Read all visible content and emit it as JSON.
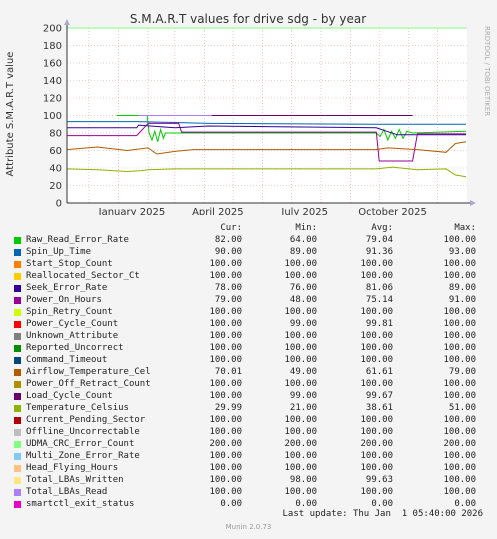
{
  "chart_data": {
    "type": "line",
    "title": "S.M.A.R.T values for drive sdg - by year",
    "ylabel": "Attribute S.M.A.R.T value",
    "ylim": [
      0,
      200
    ],
    "y_ticks": [
      "0",
      "20",
      "40",
      "60",
      "80",
      "100",
      "120",
      "140",
      "160",
      "180",
      "200"
    ],
    "x_ticks": [
      "January 2025",
      "April 2025",
      "July 2025",
      "October 2025"
    ],
    "grid": true,
    "series": [
      {
        "name": "Raw_Read_Error_Rate",
        "color": "#00cc00",
        "cur": "82.00",
        "min": "64.00",
        "avg": "79.04",
        "max": "100.00",
        "x": [
          "2024-12-30",
          "2025-01-31",
          "2025-02-02",
          "2025-02-05",
          "2025-02-08",
          "2025-02-11",
          "2025-02-14",
          "2025-02-17",
          "2025-02-19",
          "2025-03-07",
          "2025-04-01",
          "2025-09-28",
          "2025-10-02",
          "2025-10-06",
          "2025-10-10",
          "2025-10-14",
          "2025-10-18",
          "2025-10-22",
          "2025-10-26",
          "2025-10-30",
          "2025-11-05",
          "2025-12-31"
        ],
        "y": [
          100,
          100,
          80,
          72,
          82,
          70,
          84,
          74,
          80,
          80,
          80,
          80,
          76,
          84,
          72,
          82,
          74,
          84,
          74,
          82,
          80,
          82
        ]
      },
      {
        "name": "Spin_Up_Time",
        "color": "#0066b3",
        "cur": "90.00",
        "min": "89.00",
        "avg": "91.36",
        "max": "93.00",
        "x": [
          "2024-11-08",
          "2025-01-20",
          "2025-03-01",
          "2025-04-05",
          "2025-09-28",
          "2025-12-31"
        ],
        "y": [
          93,
          93,
          92,
          91,
          90,
          90
        ]
      },
      {
        "name": "Start_Stop_Count",
        "color": "#ff8000",
        "cur": "100.00",
        "min": "100.00",
        "avg": "100.00",
        "max": "100.00",
        "x": [
          "2025-01-22",
          "2025-04-08"
        ],
        "y": [
          100,
          100
        ]
      },
      {
        "name": "Reallocated_Sector_Ct",
        "color": "#ffcc00",
        "cur": "100.00",
        "min": "100.00",
        "avg": "100.00",
        "max": "100.00",
        "x": [
          "2025-01-22",
          "2025-04-08"
        ],
        "y": [
          100,
          100
        ]
      },
      {
        "name": "Seek_Error_Rate",
        "color": "#330099",
        "cur": "78.00",
        "min": "76.00",
        "avg": "81.06",
        "max": "89.00",
        "x": [
          "2024-11-08",
          "2025-01-20",
          "2025-01-22",
          "2025-03-01",
          "2025-04-05",
          "2025-09-28",
          "2025-10-20",
          "2025-12-31"
        ],
        "y": [
          86,
          86,
          89,
          86,
          88,
          86,
          78,
          78
        ]
      },
      {
        "name": "Power_On_Hours",
        "color": "#990099",
        "cur": "79.00",
        "min": "48.00",
        "avg": "75.14",
        "max": "91.00",
        "x": [
          "2024-11-08",
          "2025-01-20",
          "2025-02-01",
          "2025-03-05",
          "2025-03-08",
          "2025-04-05",
          "2025-09-28",
          "2025-10-01",
          "2025-11-05",
          "2025-11-10",
          "2025-12-31"
        ],
        "y": [
          77,
          77,
          91,
          91,
          81,
          81,
          81,
          48,
          48,
          79,
          79
        ]
      },
      {
        "name": "Spin_Retry_Count",
        "color": "#ccff00",
        "cur": "100.00",
        "min": "100.00",
        "avg": "100.00",
        "max": "100.00",
        "x": [
          "2024-11-08",
          "2025-12-31"
        ],
        "y": [
          200,
          200
        ]
      },
      {
        "name": "Power_Cycle_Count",
        "color": "#ff0000",
        "cur": "100.00",
        "min": "99.00",
        "avg": "99.81",
        "max": "100.00",
        "x": [
          "2025-01-22",
          "2025-04-08"
        ],
        "y": [
          100,
          100
        ]
      },
      {
        "name": "Unknown_Attribute",
        "color": "#808080",
        "cur": "100.00",
        "min": "100.00",
        "avg": "100.00",
        "max": "100.00",
        "x": [
          "2025-01-22",
          "2025-04-08"
        ],
        "y": [
          100,
          100
        ]
      },
      {
        "name": "Reported_Uncorrect",
        "color": "#008f00",
        "cur": "100.00",
        "min": "100.00",
        "avg": "100.00",
        "max": "100.00",
        "x": [
          "2025-01-22",
          "2025-04-08"
        ],
        "y": [
          100,
          100
        ]
      },
      {
        "name": "Command_Timeout",
        "color": "#00487d",
        "cur": "100.00",
        "min": "100.00",
        "avg": "100.00",
        "max": "100.00",
        "x": [
          "2025-01-22",
          "2025-04-08"
        ],
        "y": [
          100,
          100
        ]
      },
      {
        "name": "Airflow_Temperature_Cel",
        "color": "#b35a00",
        "cur": "70.01",
        "min": "49.00",
        "avg": "61.61",
        "max": "79.00",
        "x": [
          "2024-11-08",
          "2024-12-10",
          "2025-01-10",
          "2025-02-01",
          "2025-02-10",
          "2025-03-01",
          "2025-03-20",
          "2025-04-05",
          "2025-09-28",
          "2025-10-10",
          "2025-11-10",
          "2025-12-10",
          "2025-12-20",
          "2025-12-31"
        ],
        "y": [
          61,
          64,
          60,
          63,
          56,
          59,
          61,
          61,
          61,
          63,
          61,
          58,
          68,
          70
        ]
      },
      {
        "name": "Power_Off_Retract_Count",
        "color": "#b38f00",
        "cur": "100.00",
        "min": "100.00",
        "avg": "100.00",
        "max": "100.00",
        "x": [
          "2025-01-22",
          "2025-04-08"
        ],
        "y": [
          100,
          100
        ]
      },
      {
        "name": "Load_Cycle_Count",
        "color": "#6b006b",
        "cur": "100.00",
        "min": "99.00",
        "avg": "99.67",
        "max": "100.00",
        "x": [
          "2025-01-22",
          "2025-04-08",
          "2025-10-01",
          "2025-11-05"
        ],
        "y": [
          100,
          100,
          100,
          100
        ]
      },
      {
        "name": "Temperature_Celsius",
        "color": "#8fb300",
        "cur": "29.99",
        "min": "21.00",
        "avg": "38.61",
        "max": "51.00",
        "x": [
          "2024-11-08",
          "2024-12-10",
          "2025-01-10",
          "2025-01-25",
          "2025-02-01",
          "2025-03-01",
          "2025-04-05",
          "2025-09-28",
          "2025-10-15",
          "2025-11-10",
          "2025-12-10",
          "2025-12-20",
          "2025-12-31"
        ],
        "y": [
          39,
          38,
          36,
          37,
          38,
          39,
          39,
          39,
          41,
          38,
          39,
          32,
          30
        ]
      },
      {
        "name": "Current_Pending_Sector",
        "color": "#b30000",
        "cur": "100.00",
        "min": "100.00",
        "avg": "100.00",
        "max": "100.00",
        "x": [
          "2025-01-22",
          "2025-04-08"
        ],
        "y": [
          100,
          100
        ]
      },
      {
        "name": "Offline_Uncorrectable",
        "color": "#bebebe",
        "cur": "100.00",
        "min": "100.00",
        "avg": "100.00",
        "max": "100.00",
        "x": [
          "2025-01-22",
          "2025-04-08"
        ],
        "y": [
          100,
          100
        ]
      },
      {
        "name": "UDMA_CRC_Error_Count",
        "color": "#80ff80",
        "cur": "200.00",
        "min": "200.00",
        "avg": "200.00",
        "max": "200.00",
        "x": [
          "2024-11-08",
          "2025-12-31"
        ],
        "y": [
          200,
          200
        ]
      },
      {
        "name": "Multi_Zone_Error_Rate",
        "color": "#80c9ff",
        "cur": "100.00",
        "min": "100.00",
        "avg": "100.00",
        "max": "100.00",
        "x": [
          "2025-01-22",
          "2025-04-08"
        ],
        "y": [
          100,
          100
        ]
      },
      {
        "name": "Head_Flying_Hours",
        "color": "#ffc080",
        "cur": "100.00",
        "min": "100.00",
        "avg": "100.00",
        "max": "100.00",
        "x": [
          "2025-01-22",
          "2025-04-08"
        ],
        "y": [
          100,
          100
        ]
      },
      {
        "name": "Total_LBAs_Written",
        "color": "#ffe680",
        "cur": "100.00",
        "min": "98.00",
        "avg": "99.63",
        "max": "100.00",
        "x": [
          "2025-01-22",
          "2025-04-08"
        ],
        "y": [
          100,
          100
        ]
      },
      {
        "name": "Total_LBAs_Read",
        "color": "#aa80ff",
        "cur": "100.00",
        "min": "100.00",
        "avg": "100.00",
        "max": "100.00",
        "x": [
          "2025-01-22",
          "2025-04-08"
        ],
        "y": [
          100,
          100
        ]
      },
      {
        "name": "smartctl_exit_status",
        "color": "#ee00cc",
        "cur": "0.00",
        "min": "0.00",
        "avg": "0.00",
        "max": "0.00",
        "x": [
          "2024-11-08",
          "2025-12-31"
        ],
        "y": [
          0,
          0
        ]
      }
    ]
  },
  "legend_headers": {
    "cur": "Cur:",
    "min": "Min:",
    "avg": "Avg:",
    "max": "Max:"
  },
  "last_update": "Last update: Thu Jan  1 05:40:00 2026",
  "munin_version": "Munin 2.0.73",
  "side_label": "RRDTOOL / TOBI OETIKER"
}
